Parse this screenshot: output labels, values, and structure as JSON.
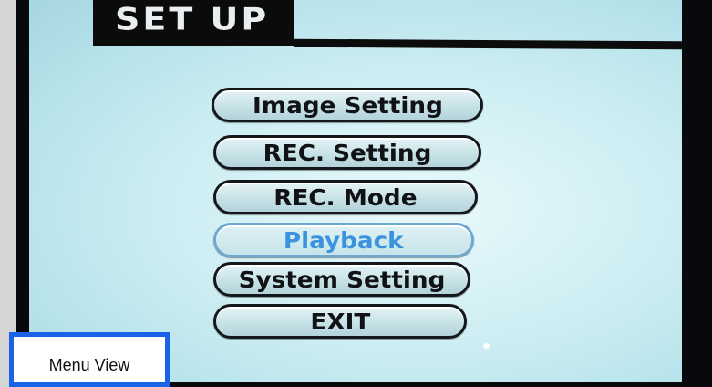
{
  "screen": {
    "title": "SET UP"
  },
  "menu": {
    "items": [
      {
        "label": "Image Setting",
        "state": "normal"
      },
      {
        "label": "REC. Setting",
        "state": "normal"
      },
      {
        "label": "REC. Mode",
        "state": "normal"
      },
      {
        "label": "Playback",
        "state": "highlighted"
      },
      {
        "label": "System Setting",
        "state": "normal"
      },
      {
        "label": "EXIT",
        "state": "normal"
      }
    ],
    "highlight_color": "#3a93dc"
  },
  "caption": {
    "label": "Menu View",
    "border_color": "#1a63e8"
  }
}
